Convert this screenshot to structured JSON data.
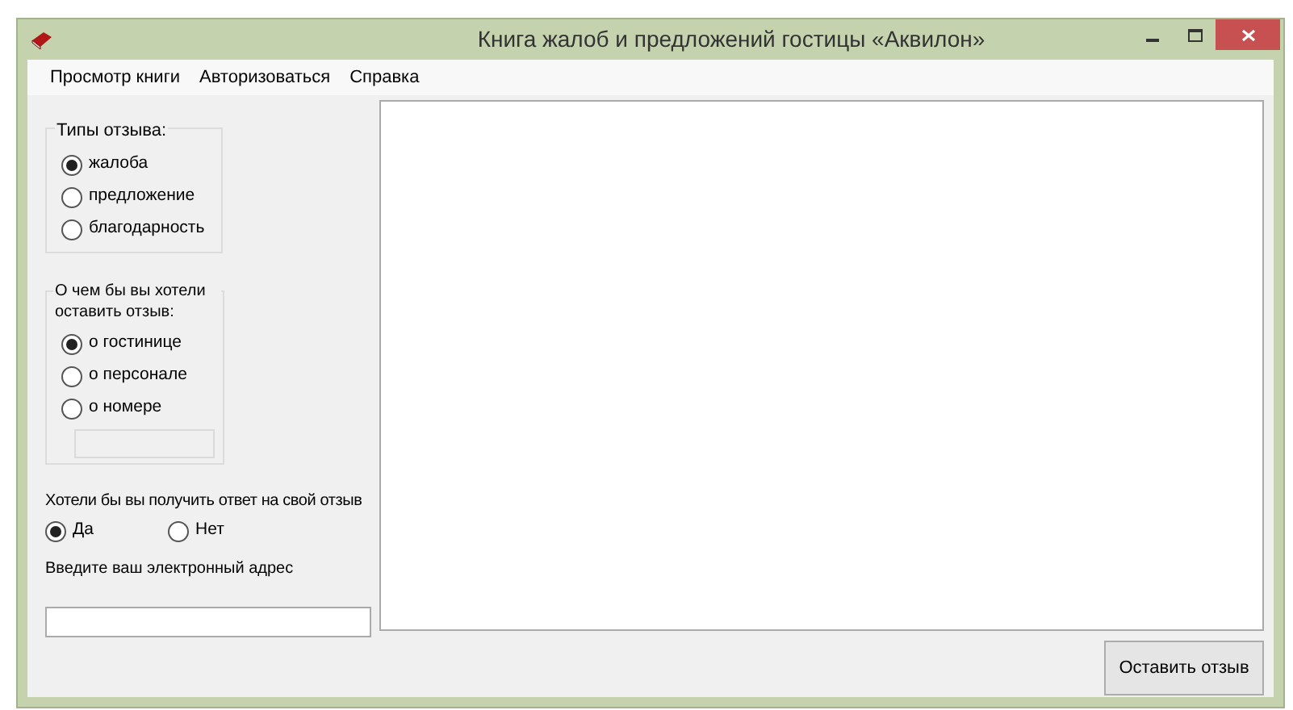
{
  "window": {
    "title": "Книга жалоб и предложений гостицы «Аквилон»"
  },
  "menu": [
    "Просмотр книги",
    "Авторизоваться",
    "Справка"
  ],
  "review_types": {
    "label": "Типы отзыва:",
    "options": [
      {
        "label": "жалоба",
        "selected": true
      },
      {
        "label": "предложение",
        "selected": false
      },
      {
        "label": "благодарность",
        "selected": false
      }
    ]
  },
  "subject": {
    "label": "О чем бы вы хотели оставить отзыв:",
    "options": [
      {
        "label": "о гостинице",
        "selected": true
      },
      {
        "label": "о персонале",
        "selected": false
      },
      {
        "label": "о номере",
        "selected": false
      }
    ],
    "room_field": {
      "disabled": true
    }
  },
  "reply": {
    "question": "Хотели бы вы получить ответ на свой отзыв",
    "options": [
      {
        "label": "Да",
        "selected": true
      },
      {
        "label": "Нет",
        "selected": false
      }
    ]
  },
  "email": {
    "label": "Введите ваш электронный адрес"
  },
  "submit_button": "Оставить отзыв"
}
